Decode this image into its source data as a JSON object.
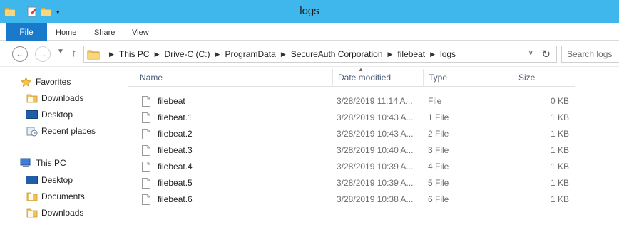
{
  "window": {
    "title": "logs"
  },
  "ribbon": {
    "tabs": [
      {
        "label": "File"
      },
      {
        "label": "Home"
      },
      {
        "label": "Share"
      },
      {
        "label": "View"
      }
    ]
  },
  "address": {
    "breadcrumbs": [
      "This PC",
      "Drive-C (C:)",
      "ProgramData",
      "SecureAuth Corporation",
      "filebeat",
      "logs"
    ],
    "search_placeholder": "Search logs"
  },
  "navigation": {
    "favorites": {
      "label": "Favorites",
      "items": [
        {
          "label": "Downloads",
          "icon": "downloads-folder-icon"
        },
        {
          "label": "Desktop",
          "icon": "desktop-icon"
        },
        {
          "label": "Recent places",
          "icon": "recent-places-icon"
        }
      ]
    },
    "this_pc": {
      "label": "This PC",
      "items": [
        {
          "label": "Desktop",
          "icon": "desktop-folder-icon"
        },
        {
          "label": "Documents",
          "icon": "documents-folder-icon"
        },
        {
          "label": "Downloads",
          "icon": "downloads-folder-icon"
        }
      ]
    }
  },
  "columns": [
    "Name",
    "Date modified",
    "Type",
    "Size"
  ],
  "files": [
    {
      "name": "filebeat",
      "date": "3/28/2019 11:14 A...",
      "type": "File",
      "size": "0 KB"
    },
    {
      "name": "filebeat.1",
      "date": "3/28/2019 10:43 A...",
      "type": "1 File",
      "size": "1 KB"
    },
    {
      "name": "filebeat.2",
      "date": "3/28/2019 10:43 A...",
      "type": "2 File",
      "size": "1 KB"
    },
    {
      "name": "filebeat.3",
      "date": "3/28/2019 10:40 A...",
      "type": "3 File",
      "size": "1 KB"
    },
    {
      "name": "filebeat.4",
      "date": "3/28/2019 10:39 A...",
      "type": "4 File",
      "size": "1 KB"
    },
    {
      "name": "filebeat.5",
      "date": "3/28/2019 10:39 A...",
      "type": "5 File",
      "size": "1 KB"
    },
    {
      "name": "filebeat.6",
      "date": "3/28/2019 10:38 A...",
      "type": "6 File",
      "size": "1 KB"
    }
  ],
  "colors": {
    "titlebar": "#3fb6ec",
    "file_tab": "#1979ca",
    "header_text": "#4c607a",
    "secondary_text": "#6d6d6d"
  }
}
